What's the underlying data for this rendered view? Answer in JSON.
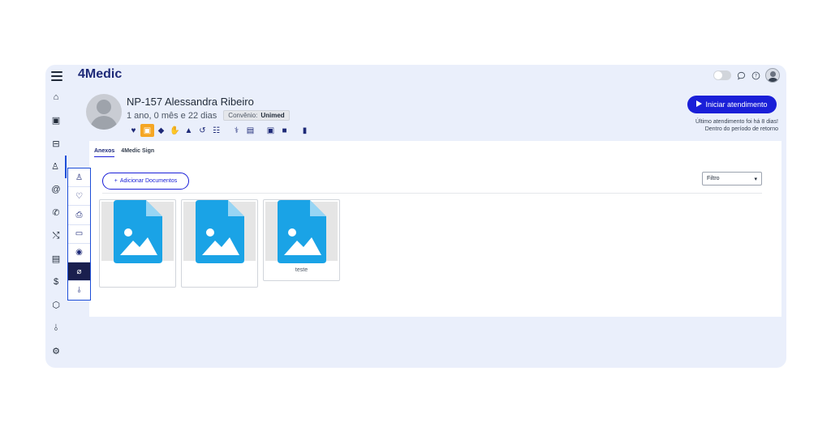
{
  "brand": {
    "logo_text": "4Medic"
  },
  "topbar": {
    "icons": [
      "toggle-switch",
      "chat-icon",
      "help-icon",
      "user-avatar"
    ]
  },
  "rail": {
    "items": [
      {
        "icon": "home-icon",
        "glyph": "⌂"
      },
      {
        "icon": "calendar-icon",
        "glyph": "▣"
      },
      {
        "icon": "inbox-icon",
        "glyph": "⊟"
      },
      {
        "icon": "user-icon",
        "glyph": "♙",
        "active": true
      },
      {
        "icon": "at-icon",
        "glyph": "@"
      },
      {
        "icon": "phone-icon",
        "glyph": "✆"
      },
      {
        "icon": "shuffle-icon",
        "glyph": "⤭"
      },
      {
        "icon": "clipboard-icon",
        "glyph": "▤"
      },
      {
        "icon": "dollar-icon",
        "glyph": "$"
      },
      {
        "icon": "box-icon",
        "glyph": "⬡"
      },
      {
        "icon": "chart-icon",
        "glyph": "⫰"
      },
      {
        "icon": "settings-icon",
        "glyph": "⚙"
      }
    ]
  },
  "patient": {
    "name": "NP-157 Alessandra Ribeiro",
    "age": "1 ano, 0 mês e 22 dias",
    "convenio_label": "Convênio:",
    "convenio_value": "Unimed",
    "icons": [
      {
        "icon": "heart-pulse-icon",
        "glyph": "♥"
      },
      {
        "icon": "calendar-icon",
        "glyph": "▣",
        "selected": true
      },
      {
        "icon": "pill-icon",
        "glyph": "◆"
      },
      {
        "icon": "hand-icon",
        "glyph": "✋"
      },
      {
        "icon": "warning-icon",
        "glyph": "▲"
      },
      {
        "icon": "history-icon",
        "glyph": "↺"
      },
      {
        "icon": "table-icon",
        "glyph": "☷"
      },
      {
        "icon": "stethoscope-icon",
        "glyph": "⚕"
      },
      {
        "icon": "document-icon",
        "glyph": "▤"
      },
      {
        "icon": "calendar-check-icon",
        "glyph": "▣"
      },
      {
        "icon": "video-icon",
        "glyph": "■"
      },
      {
        "icon": "book-icon",
        "glyph": "▮"
      }
    ]
  },
  "actions": {
    "start_label": "Iniciar atendimento",
    "last_visit": "Último atendimento foi há 8 dias!",
    "return_period": "Dentro do período de retorno"
  },
  "tabs": [
    {
      "label": "Anexos",
      "active": true
    },
    {
      "label": "4Medic Sign",
      "active": false
    }
  ],
  "documents": {
    "add_label": "Adicionar Documentos",
    "filter_label": "Filtro",
    "items": [
      {
        "caption": ""
      },
      {
        "caption": ""
      },
      {
        "caption": "teste"
      }
    ]
  },
  "subrail": {
    "items": [
      {
        "icon": "user-icon",
        "glyph": "♙"
      },
      {
        "icon": "heart-pulse-icon",
        "glyph": "♡"
      },
      {
        "icon": "printer-icon",
        "glyph": "⎙"
      },
      {
        "icon": "folder-icon",
        "glyph": "▭"
      },
      {
        "icon": "camera-icon",
        "glyph": "◉"
      },
      {
        "icon": "paperclip-icon",
        "glyph": "⌀",
        "active": true
      },
      {
        "icon": "chart-icon",
        "glyph": "⫰"
      }
    ]
  },
  "colors": {
    "accent": "#1a1fd8",
    "selected": "#f5a623",
    "file_icon": "#1aa3e6",
    "background": "#eaeffb"
  }
}
